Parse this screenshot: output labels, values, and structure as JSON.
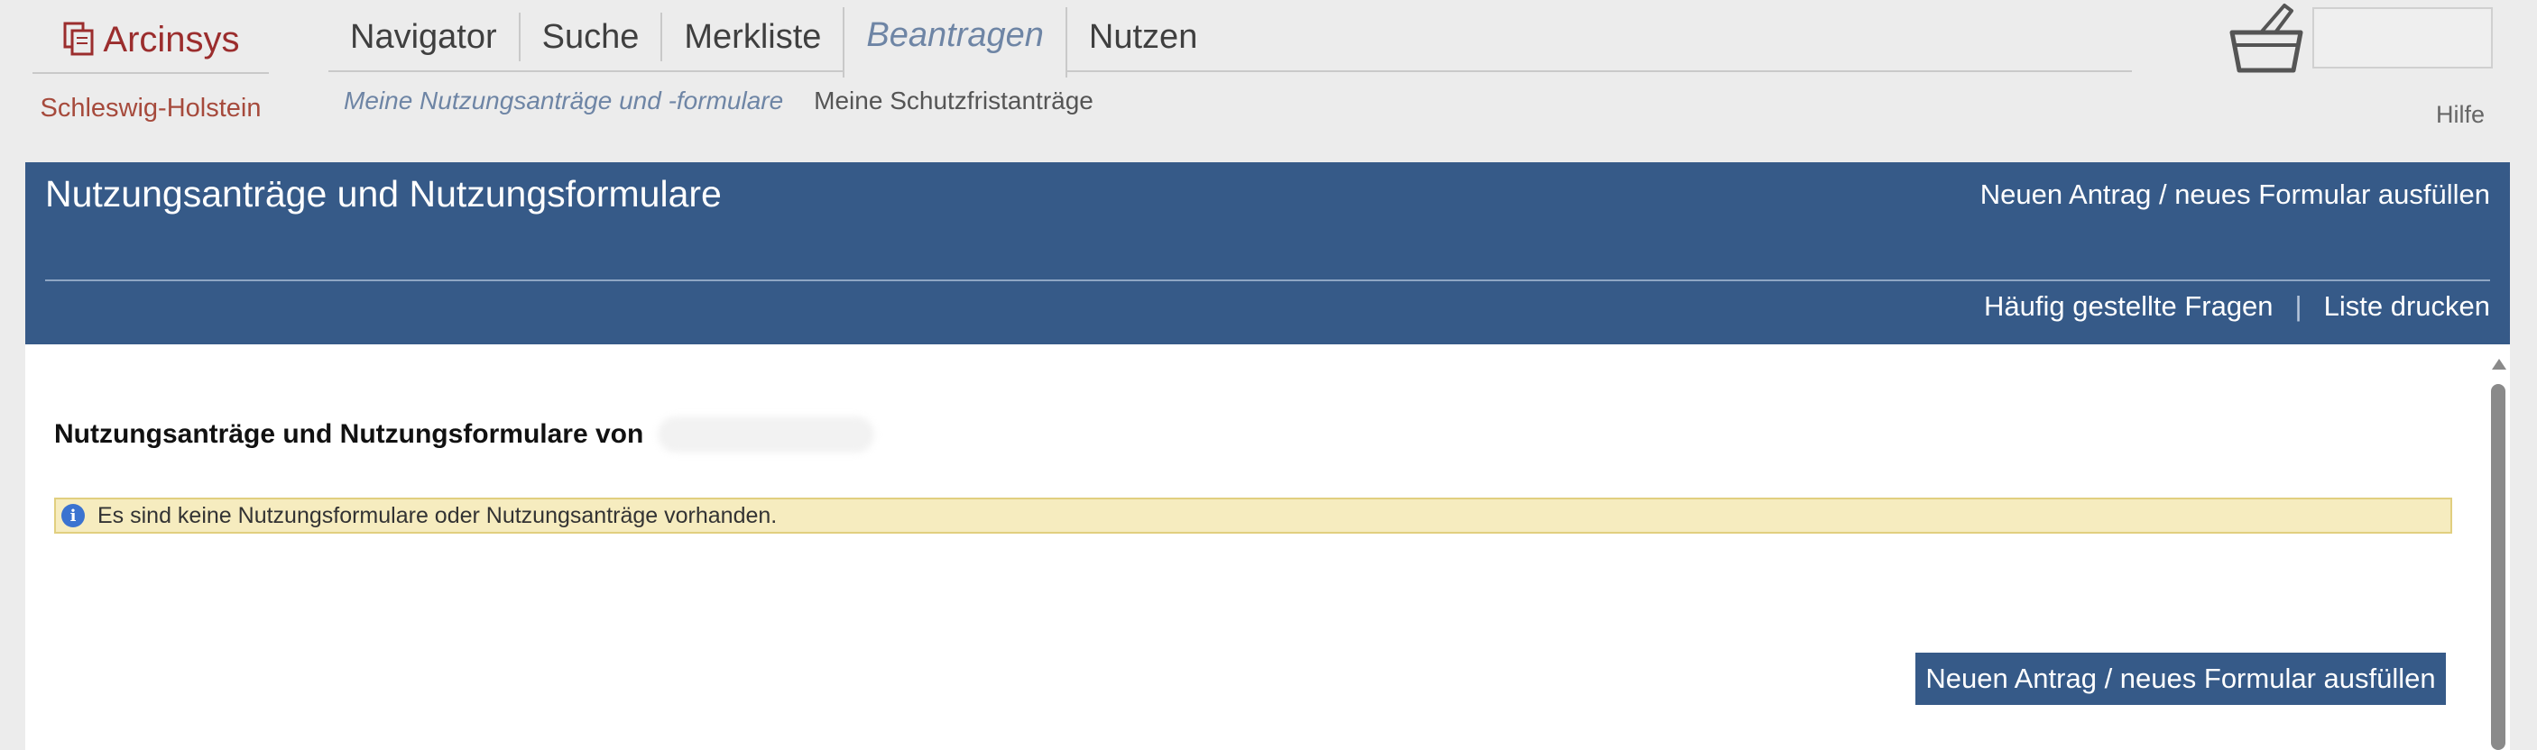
{
  "header": {
    "logo_text": "Arcinsys",
    "region": "Schleswig-Holstein",
    "nav": [
      {
        "label": "Navigator"
      },
      {
        "label": "Suche"
      },
      {
        "label": "Merkliste"
      },
      {
        "label": "Beantragen",
        "active": true
      },
      {
        "label": "Nutzen"
      }
    ],
    "subnav": [
      {
        "label": "Meine Nutzungsanträge und -formulare",
        "active": true
      },
      {
        "label": "Meine Schutzfristanträge"
      }
    ],
    "help": "Hilfe",
    "icons": {
      "logo": "documents-icon",
      "basket": "basket-icon"
    }
  },
  "panel": {
    "title": "Nutzungsanträge und Nutzungsformulare",
    "new_link": "Neuen Antrag / neues Formular ausfüllen",
    "faq": "Häufig gestellte Fragen",
    "separator": "|",
    "print": "Liste drucken"
  },
  "content": {
    "heading": "Nutzungsanträge und Nutzungsformulare von",
    "info_message": "Es sind keine Nutzungsformulare oder Nutzungsanträge vorhanden.",
    "info_icon": "i",
    "new_button": "Neuen Antrag / neues Formular ausfüllen"
  },
  "colors": {
    "brand": "#9b2d2d",
    "panel_blue": "#365a88",
    "info_bg": "#f6ecbf",
    "active_nav": "#6e85a5"
  }
}
